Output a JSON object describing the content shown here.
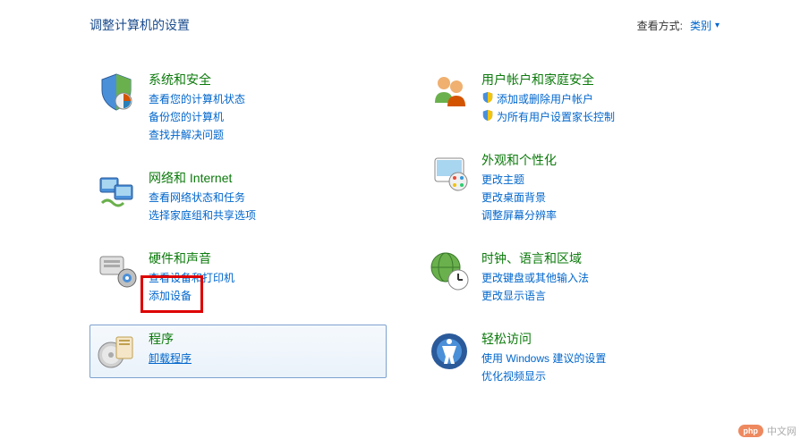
{
  "header": {
    "title": "调整计算机的设置",
    "view_by_label": "查看方式:",
    "view_by_value": "类别"
  },
  "left_column": [
    {
      "id": "system-security",
      "title": "系统和安全",
      "links": [
        {
          "text": "查看您的计算机状态",
          "shield": false
        },
        {
          "text": "备份您的计算机",
          "shield": false
        },
        {
          "text": "查找并解决问题",
          "shield": false
        }
      ]
    },
    {
      "id": "network-internet",
      "title": "网络和 Internet",
      "links": [
        {
          "text": "查看网络状态和任务",
          "shield": false
        },
        {
          "text": "选择家庭组和共享选项",
          "shield": false
        }
      ]
    },
    {
      "id": "hardware-sound",
      "title": "硬件和声音",
      "links": [
        {
          "text": "查看设备和打印机",
          "shield": false
        },
        {
          "text": "添加设备",
          "shield": false
        }
      ]
    },
    {
      "id": "programs",
      "title": "程序",
      "highlighted": true,
      "links": [
        {
          "text": "卸载程序",
          "shield": false,
          "underline": true
        }
      ]
    }
  ],
  "right_column": [
    {
      "id": "user-accounts",
      "title": "用户帐户和家庭安全",
      "links": [
        {
          "text": "添加或删除用户帐户",
          "shield": true
        },
        {
          "text": "为所有用户设置家长控制",
          "shield": true
        }
      ]
    },
    {
      "id": "appearance",
      "title": "外观和个性化",
      "links": [
        {
          "text": "更改主题",
          "shield": false
        },
        {
          "text": "更改桌面背景",
          "shield": false
        },
        {
          "text": "调整屏幕分辨率",
          "shield": false
        }
      ]
    },
    {
      "id": "clock-language",
      "title": "时钟、语言和区域",
      "links": [
        {
          "text": "更改键盘或其他输入法",
          "shield": false
        },
        {
          "text": "更改显示语言",
          "shield": false
        }
      ]
    },
    {
      "id": "ease-of-access",
      "title": "轻松访问",
      "links": [
        {
          "text": "使用 Windows 建议的设置",
          "shield": false
        },
        {
          "text": "优化视频显示",
          "shield": false
        }
      ]
    }
  ],
  "watermark": {
    "badge": "php",
    "text": "中文网"
  }
}
